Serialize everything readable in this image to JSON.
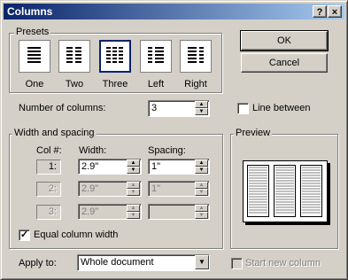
{
  "window": {
    "title": "Columns",
    "help_button": "?",
    "close_button": "×"
  },
  "buttons": {
    "ok": "OK",
    "cancel": "Cancel"
  },
  "presets": {
    "group_label": "Presets",
    "items": [
      {
        "label": "One",
        "icon": "one-column-icon"
      },
      {
        "label": "Two",
        "icon": "two-columns-icon"
      },
      {
        "label": "Three",
        "icon": "three-columns-icon",
        "selected": true
      },
      {
        "label": "Left",
        "icon": "left-column-icon"
      },
      {
        "label": "Right",
        "icon": "right-column-icon"
      }
    ]
  },
  "number_of_columns": {
    "label": "Number of columns:",
    "value": "3"
  },
  "line_between": {
    "label": "Line between",
    "checked": false
  },
  "width_spacing": {
    "group_label": "Width and spacing",
    "col_header": "Col #:",
    "width_header": "Width:",
    "spacing_header": "Spacing:",
    "rows": [
      {
        "col": "1:",
        "width": "2.9\"",
        "spacing": "1\"",
        "enabled": true
      },
      {
        "col": "2:",
        "width": "2.9\"",
        "spacing": "1\"",
        "enabled": false
      },
      {
        "col": "3:",
        "width": "2.9\"",
        "spacing": "",
        "enabled": false
      }
    ],
    "equal_width": {
      "label": "Equal column width",
      "checked": true
    }
  },
  "preview": {
    "group_label": "Preview",
    "columns": 3
  },
  "apply_to": {
    "label": "Apply to:",
    "value": "Whole document"
  },
  "start_new_column": {
    "label": "Start new column",
    "checked": false,
    "enabled": false
  }
}
